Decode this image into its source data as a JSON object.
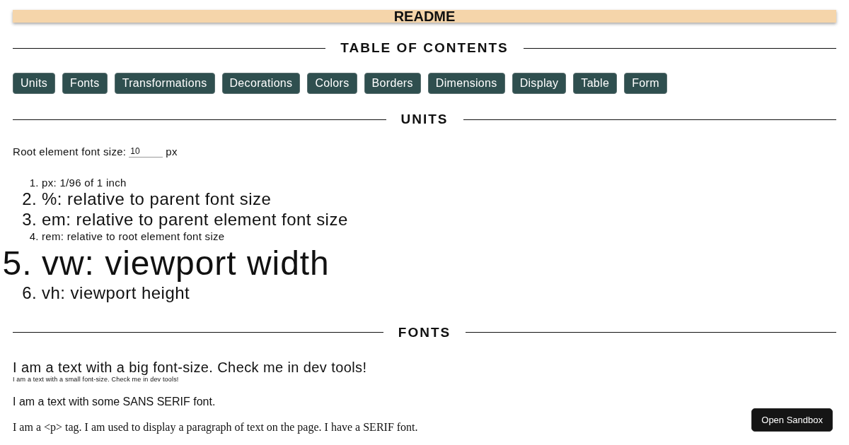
{
  "header": {
    "title": "README"
  },
  "toc": {
    "heading": "TABLE OF CONTENTS",
    "links": [
      "Units",
      "Fonts",
      "Transformations",
      "Decorations",
      "Colors",
      "Borders",
      "Dimensions",
      "Display",
      "Table",
      "Form"
    ]
  },
  "units": {
    "heading": "UNITS",
    "root_size": {
      "label": "Root element font size:",
      "value": "10",
      "suffix": "px"
    },
    "items": [
      {
        "marker": "1.",
        "text": "px: 1/96 of 1 inch",
        "kind": "small"
      },
      {
        "marker": "2.",
        "text": "%: relative to parent font size",
        "kind": "medium"
      },
      {
        "marker": "3.",
        "text": "em: relative to parent element font size",
        "kind": "medium"
      },
      {
        "marker": "4.",
        "text": "rem: relative to root element font size",
        "kind": "small"
      },
      {
        "marker": "5.",
        "text": "vw: viewport width",
        "kind": "large"
      },
      {
        "marker": "6.",
        "text": "vh: viewport height",
        "kind": "medium"
      }
    ]
  },
  "fonts": {
    "heading": "FONTS",
    "samples": [
      {
        "text": "I am a text with a big font-size. Check me in dev tools!",
        "kind": "big"
      },
      {
        "text": "I am a text with a small font-size. Check me in dev tools!",
        "kind": "tiny"
      },
      {
        "text": "I am a text with some SANS SERIF font.",
        "kind": "sans"
      },
      {
        "text": "I am a <p> tag. I am used to display a paragraph of text on the page. I have a SERIF font.",
        "kind": "serif"
      }
    ]
  },
  "sandbox_button": "Open Sandbox"
}
